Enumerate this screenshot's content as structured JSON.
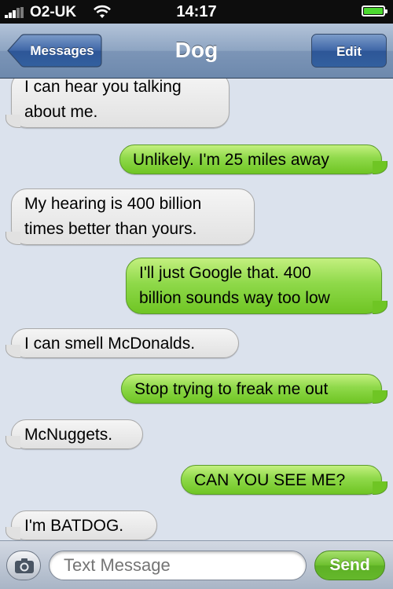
{
  "status_bar": {
    "carrier": "O2-UK",
    "time": "14:17",
    "signal_icon": "signal-bars-icon",
    "wifi_icon": "wifi-icon",
    "battery_icon": "battery-icon",
    "battery_level": 1.0
  },
  "nav": {
    "back_label": "Messages",
    "title": "Dog",
    "edit_label": "Edit"
  },
  "messages": [
    {
      "direction": "incoming",
      "lines": [
        "I can hear you talking",
        "about me."
      ]
    },
    {
      "direction": "outgoing",
      "lines": [
        "Unlikely. I'm 25 miles away"
      ]
    },
    {
      "direction": "incoming",
      "lines": [
        "My hearing is 400 billion",
        "times better than yours."
      ]
    },
    {
      "direction": "outgoing",
      "lines": [
        "I'll just Google that. 400",
        "billion sounds way too low"
      ]
    },
    {
      "direction": "incoming",
      "lines": [
        "I can smell McDonalds."
      ]
    },
    {
      "direction": "outgoing",
      "lines": [
        "Stop trying to freak me out"
      ]
    },
    {
      "direction": "incoming",
      "lines": [
        "McNuggets."
      ]
    },
    {
      "direction": "outgoing",
      "lines": [
        "CAN YOU SEE ME?"
      ]
    },
    {
      "direction": "incoming",
      "lines": [
        "I'm BATDOG."
      ]
    }
  ],
  "composer": {
    "camera_icon": "camera-icon",
    "placeholder": "Text Message",
    "send_label": "Send"
  },
  "colors": {
    "incoming_bubble": "#e6e6e6",
    "outgoing_bubble": "#8fd94a",
    "thread_background": "#dbe2ed",
    "nav_bar": "#8da4c2"
  }
}
